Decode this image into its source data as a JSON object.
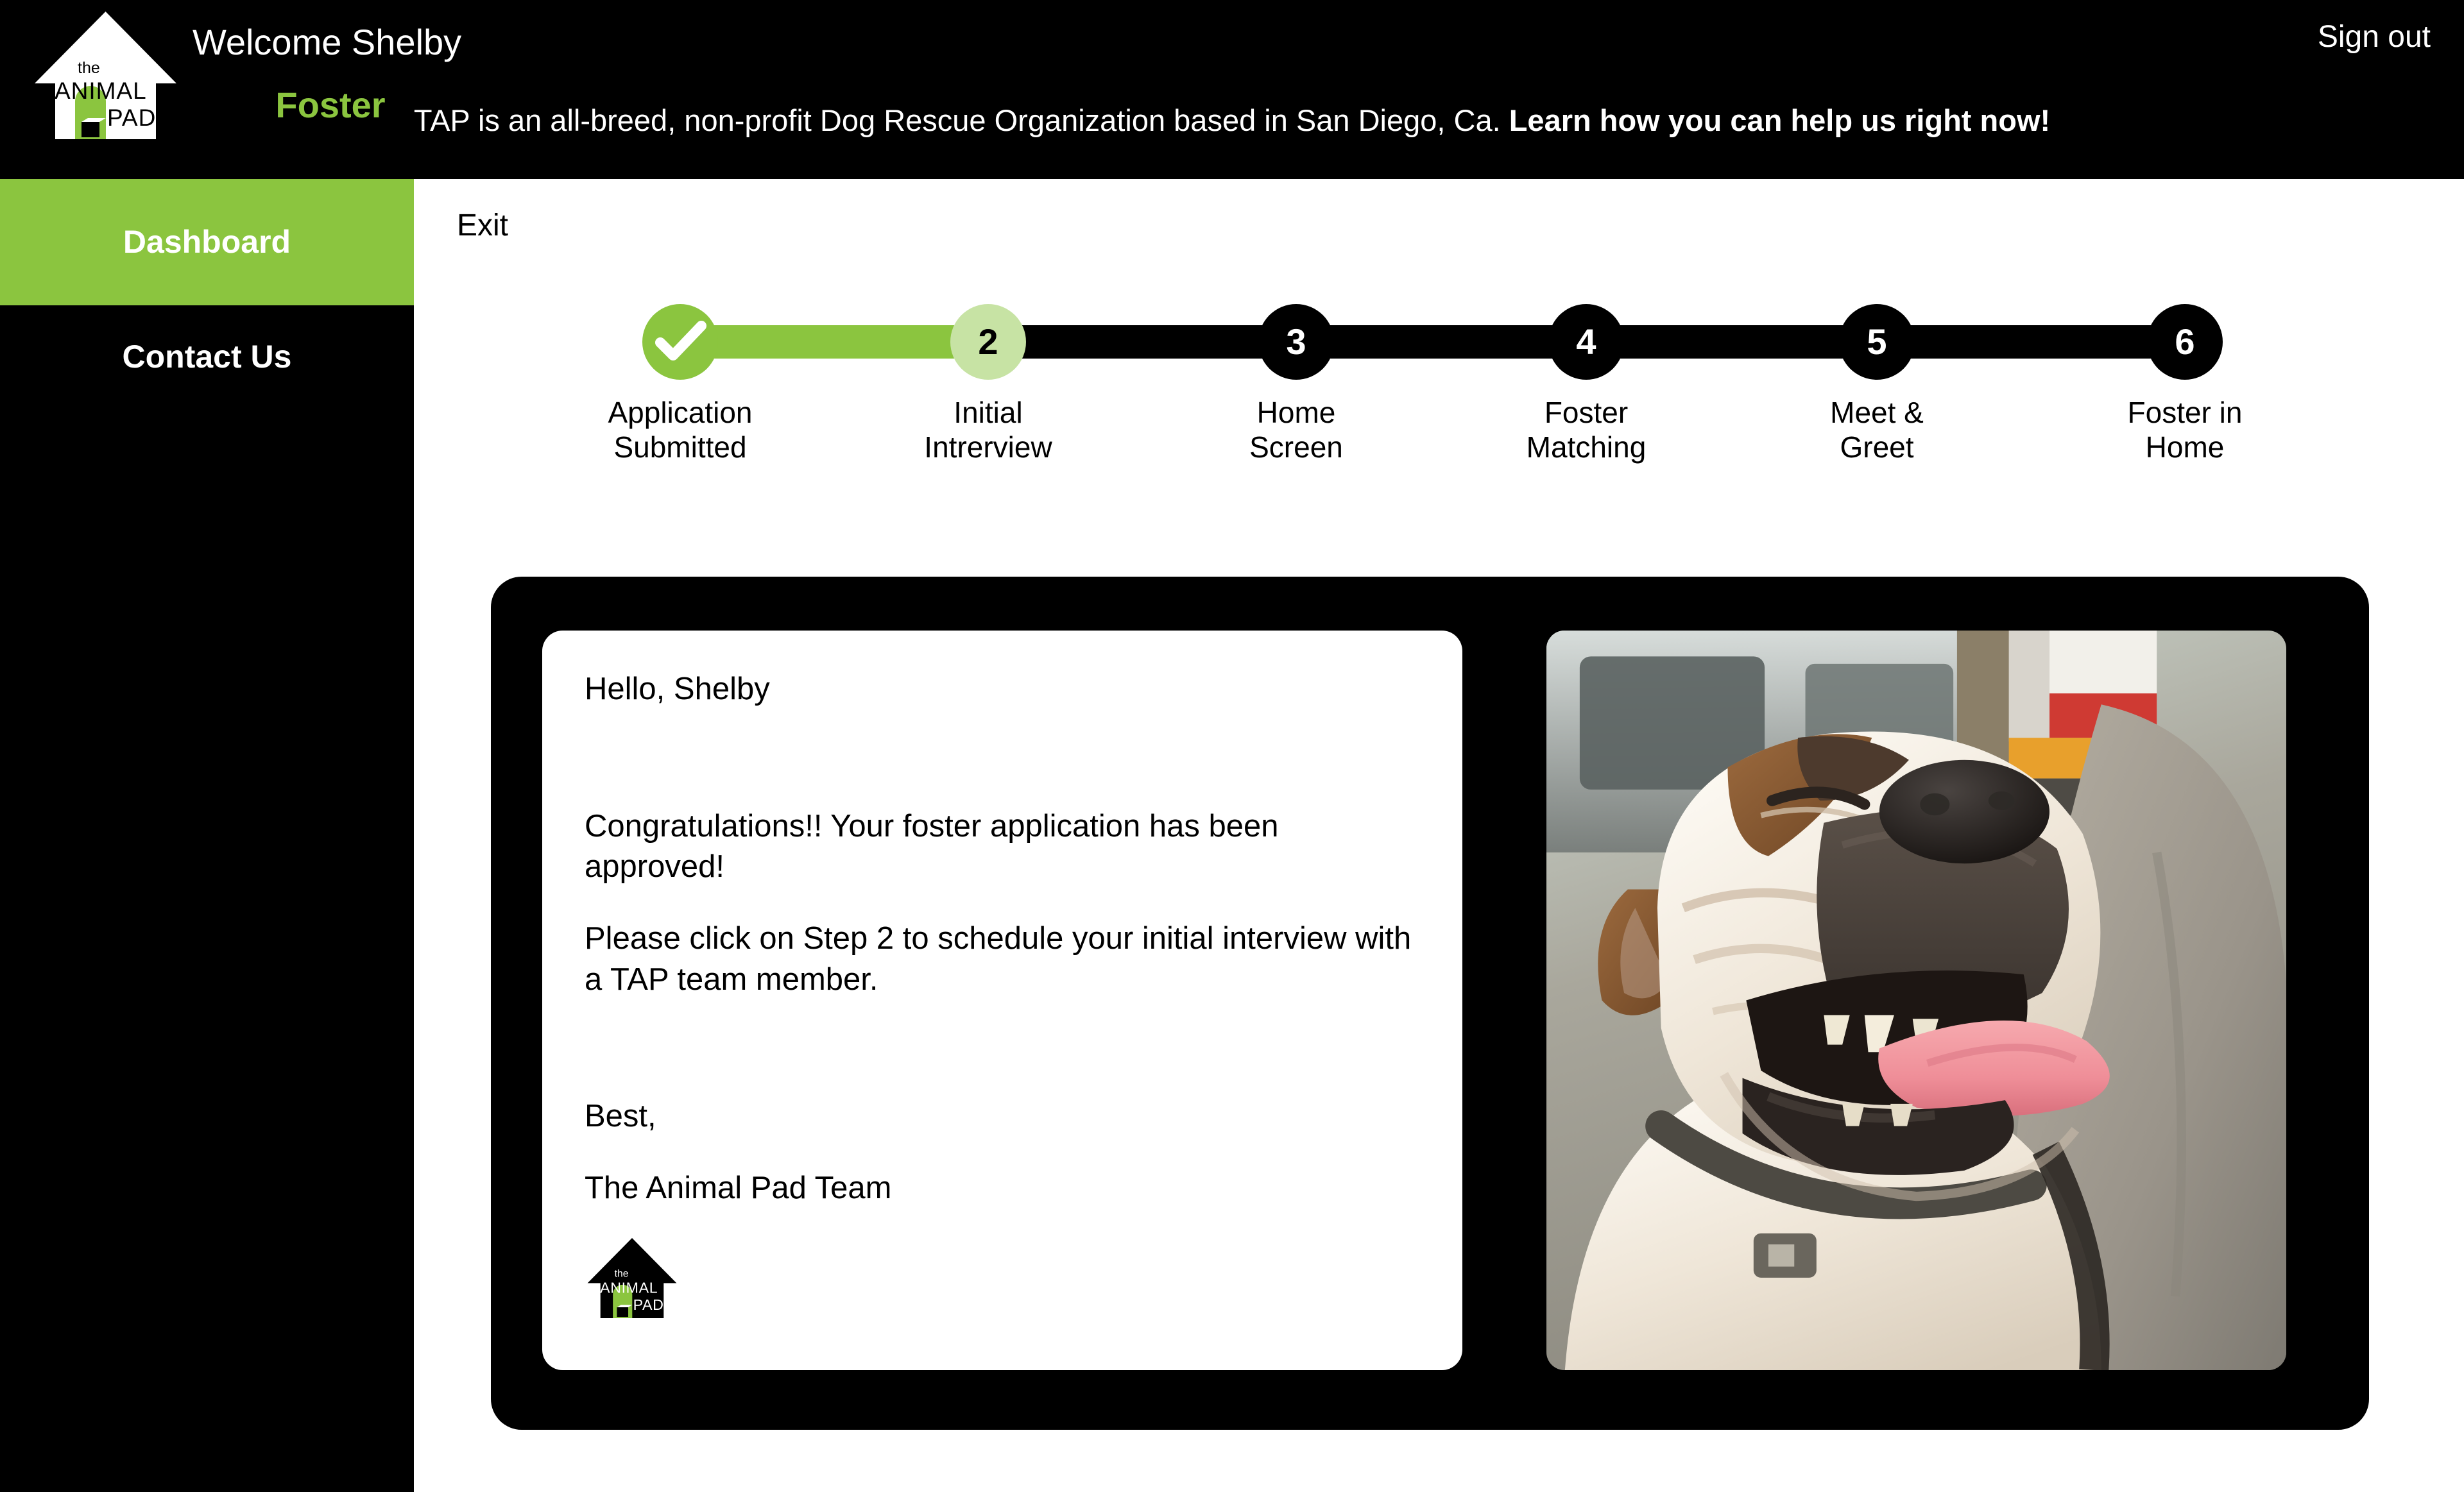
{
  "header": {
    "logo_alt": "The Animal Pad logo",
    "logo_text_line1": "the",
    "logo_text_line2": "ANIMAL",
    "logo_text_line3": "PAD",
    "welcome": "Welcome Shelby",
    "role": "Foster",
    "sign_out": "Sign out",
    "mission_text": "TAP is an all-breed, non-profit Dog Rescue Organization based in San Diego, Ca. ",
    "mission_cta": "Learn how you can help us right now!"
  },
  "sidebar": {
    "items": [
      {
        "label": "Dashboard",
        "active": true
      },
      {
        "label": "Contact Us",
        "active": false
      }
    ]
  },
  "main": {
    "exit_label": "Exit"
  },
  "stepper": {
    "current_step": 2,
    "colors": {
      "completed": "#8bc53f",
      "active": "#c7e3a4",
      "pending": "#000000"
    },
    "steps": [
      {
        "number": "1",
        "marker": "check",
        "state": "completed",
        "label": "Application\nSubmitted"
      },
      {
        "number": "2",
        "marker": "2",
        "state": "active",
        "label": "Initial\nIntrerview"
      },
      {
        "number": "3",
        "marker": "3",
        "state": "pending",
        "label": "Home\nScreen"
      },
      {
        "number": "4",
        "marker": "4",
        "state": "pending",
        "label": "Foster\nMatching"
      },
      {
        "number": "5",
        "marker": "5",
        "state": "pending",
        "label": "Meet &\nGreet"
      },
      {
        "number": "6",
        "marker": "6",
        "state": "pending",
        "label": "Foster in\nHome"
      }
    ]
  },
  "message_card": {
    "greeting": "Hello, Shelby",
    "congrats": "Congratulations!! Your foster application has been approved!",
    "instruction": "Please click on Step 2 to schedule your initial interview with a TAP team member.",
    "signoff": "Best,",
    "team": "The Animal Pad Team",
    "logo_text_line1": "the",
    "logo_text_line2": "ANIMAL",
    "logo_text_line3": "PAD"
  },
  "photo": {
    "alt": "Smiling bulldog riding in a car with tongue out"
  }
}
